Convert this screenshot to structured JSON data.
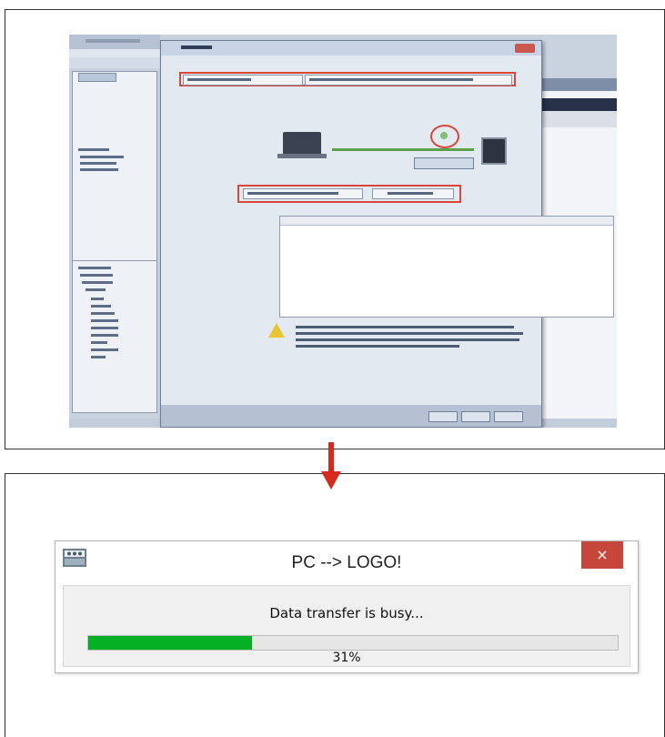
{
  "progress_dialog": {
    "title": "PC --> LOGO!",
    "close_glyph": "×",
    "message": "Data transfer is busy...",
    "progress_fraction": 0.31,
    "progress_label": "31%",
    "icon": "logo-app-icon",
    "progress_color": "#06b025",
    "close_color": "#c7463c"
  },
  "arrow": {
    "icon": "arrow-down-icon",
    "color": "#d62a1c"
  },
  "interface_dialog": {
    "icon": "warning-icon",
    "highlight_color": "#d8473a"
  }
}
